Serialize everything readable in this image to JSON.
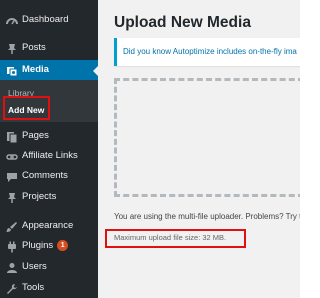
{
  "sidebar": {
    "items": [
      {
        "label": "Dashboard",
        "icon": "dashboard-icon"
      },
      {
        "label": "Posts",
        "icon": "pin-icon"
      },
      {
        "label": "Media",
        "icon": "media-icon",
        "active": true
      },
      {
        "label": "Pages",
        "icon": "pages-icon"
      },
      {
        "label": "Affiliate Links",
        "icon": "link-icon"
      },
      {
        "label": "Comments",
        "icon": "comment-icon"
      },
      {
        "label": "Projects",
        "icon": "pin-icon"
      },
      {
        "label": "Appearance",
        "icon": "brush-icon"
      },
      {
        "label": "Plugins",
        "icon": "plugin-icon",
        "badge": "1"
      },
      {
        "label": "Users",
        "icon": "users-icon"
      },
      {
        "label": "Tools",
        "icon": "wrench-icon"
      }
    ],
    "submenu": {
      "library_label": "Library",
      "add_new_label": "Add New"
    }
  },
  "main": {
    "title": "Upload New Media",
    "notice": "Did you know Autoptimize includes on-the-fly ima",
    "uploader_text": "You are using the multi-file uploader. Problems? Try t",
    "max_upload": "Maximum upload file size: 32 MB."
  },
  "colors": {
    "sidebar_bg": "#23282d",
    "submenu_bg": "#32373c",
    "active_bg": "#0073aa",
    "badge": "#d54e21",
    "highlight": "#e01010"
  }
}
